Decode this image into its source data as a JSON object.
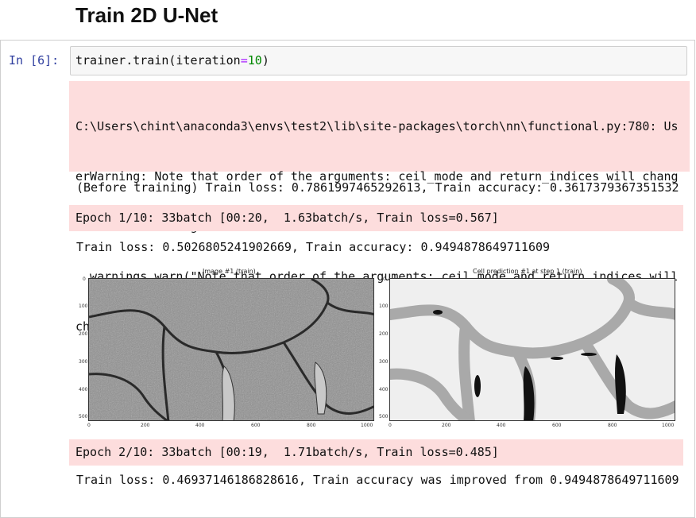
{
  "heading": "Train 2D U-Net",
  "cell": {
    "prompt": "In  [6]:",
    "code": {
      "prefix": "trainer.train(iteration",
      "op": "=",
      "num": "10",
      "suffix": ")"
    }
  },
  "stderr_lines": [
    "C:\\Users\\chint\\anaconda3\\envs\\test2\\lib\\site-packages\\torch\\nn\\functional.py:780: Us",
    "erWarning: Note that order of the arguments: ceil_mode and return_indices will chang",
    "eto match the args list in nn.MaxPool2d in a future release.",
    "  warnings.warn(\"Note that order of the arguments: ceil_mode and return_indices will",
    "change\""
  ],
  "before_training": "(Before training) Train loss: 0.7861997465292613, Train accuracy: 0.3617379367351532",
  "epoch1": "Epoch 1/10: 33batch [00:20,  1.63batch/s, Train loss=0.567]",
  "result1": "Train loss: 0.5026805241902669, Train accuracy: 0.9494878649711609",
  "figure": {
    "left_title": "Image #1 (train)",
    "right_title": "Cell prediction #1 at step 1 (train)",
    "yticks": [
      "0",
      "100",
      "200",
      "300",
      "400",
      "500"
    ],
    "xticks": [
      "0",
      "200",
      "400",
      "600",
      "800",
      "1000"
    ]
  },
  "epoch2": "Epoch 2/10: 33batch [00:19,  1.71batch/s, Train loss=0.485]",
  "result2": "Train loss: 0.46937146186828616, Train accuracy was improved from 0.9494878649711609"
}
